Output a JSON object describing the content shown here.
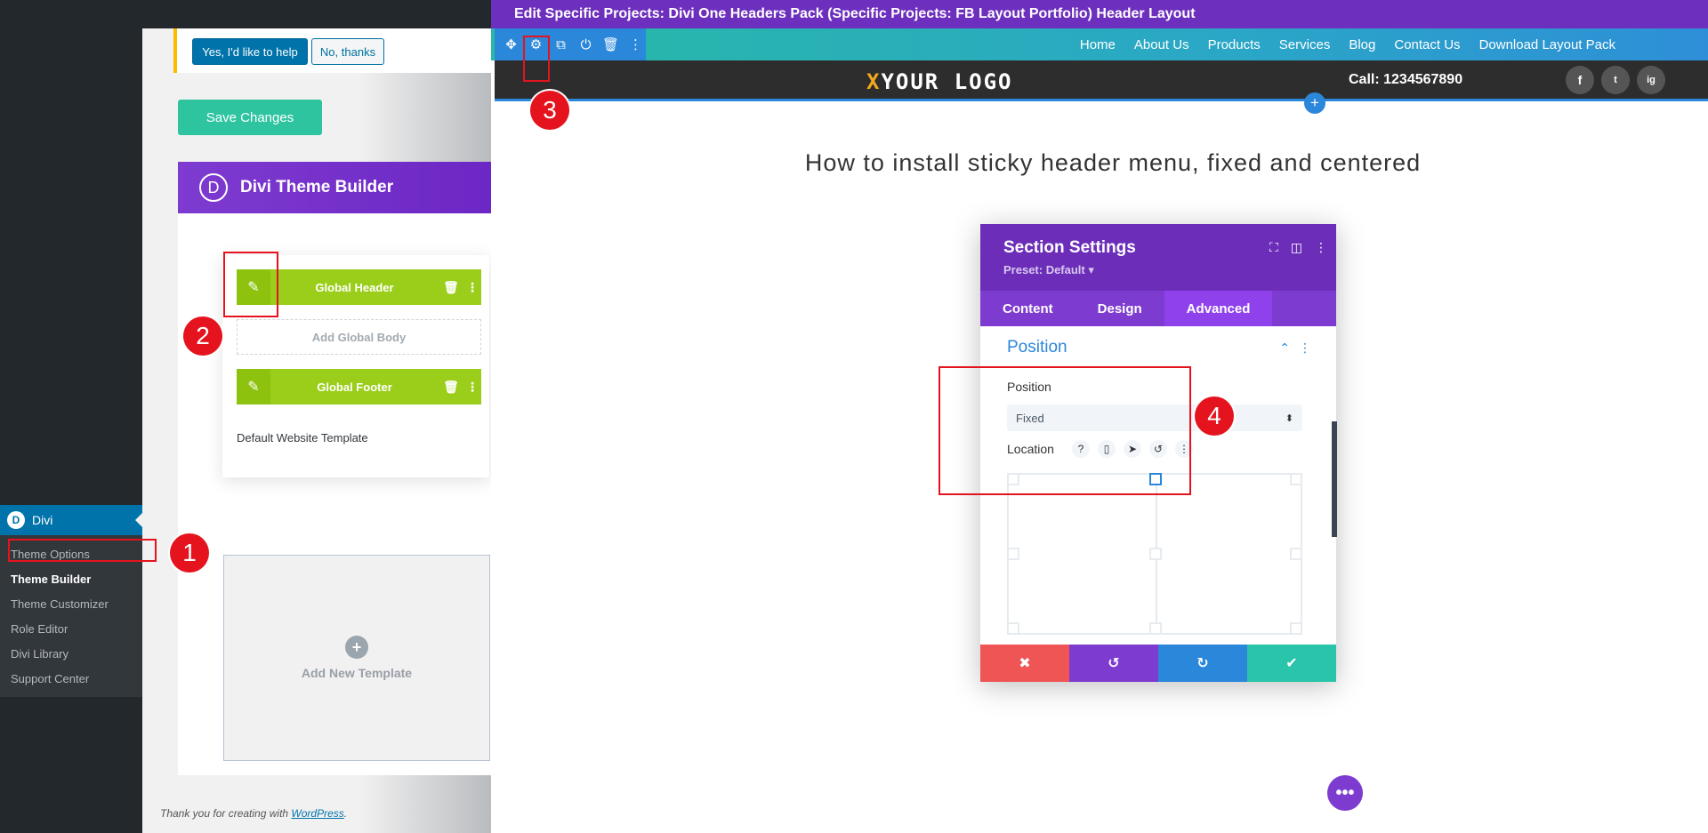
{
  "wp": {
    "notice": {
      "yes_label": "Yes, I'd like to help",
      "no_label": "No, thanks"
    },
    "save_label": "Save Changes",
    "theme_builder_title": "Divi Theme Builder",
    "divi_logo_letter": "D",
    "template": {
      "header_label": "Global Header",
      "body_label": "Add Global Body",
      "footer_label": "Global Footer",
      "name": "Default Website Template"
    },
    "add_template_label": "Add New Template",
    "footer_text": "Thank you for creating with",
    "footer_link": "WordPress",
    "footer_end": "."
  },
  "admin_menu": {
    "active_label": "Divi",
    "submenu": [
      "Theme Options",
      "Theme Builder",
      "Theme Customizer",
      "Role Editor",
      "Divi Library",
      "Support Center"
    ]
  },
  "markers": [
    "1",
    "2",
    "3",
    "4"
  ],
  "builder": {
    "title": "Edit Specific Projects: Divi One Headers Pack (Specific Projects: FB Layout Portfolio) Header Layout",
    "nav": [
      "Home",
      "About Us",
      "Products",
      "Services",
      "Blog",
      "Contact Us",
      "Download Layout Pack"
    ],
    "logo_accent": "X",
    "logo_rest": "YOUR LOGO",
    "call": "Call: 1234567890",
    "social": [
      "f",
      "t",
      "ig"
    ],
    "heading": "How to install sticky header menu, fixed and centered"
  },
  "section_settings": {
    "title": "Section Settings",
    "preset": "Preset: Default ▾",
    "tabs": [
      "Content",
      "Design",
      "Advanced"
    ],
    "active_tab": "Advanced",
    "section": "Position",
    "position_label": "Position",
    "position_value": "Fixed",
    "location_label": "Location"
  },
  "colors": {
    "divi_purple": "#6c2eb9",
    "divi_blue": "#2b87da",
    "divi_green": "#2ec4a0",
    "header_green": "#9bce1a",
    "marker_red": "#e5131d"
  }
}
